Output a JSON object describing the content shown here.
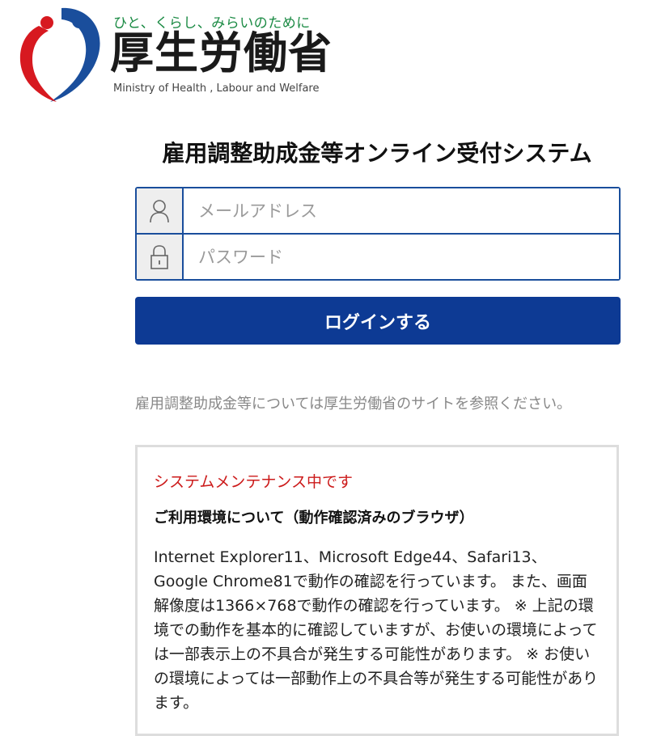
{
  "header": {
    "tagline": "ひと、くらし、みらいのために",
    "ministry_name": "厚生労働省",
    "ministry_name_en": "Ministry of Health , Labour and Welfare",
    "colors": {
      "tagline": "#1a8a43",
      "logo_blue": "#1a4e9c",
      "logo_red": "#d71920"
    }
  },
  "main": {
    "system_title": "雇用調整助成金等オンライン受付システム"
  },
  "login_form": {
    "email": {
      "placeholder": "メールアドレス",
      "value": "",
      "icon": "user-icon"
    },
    "password": {
      "placeholder": "パスワード",
      "value": "",
      "icon": "lock-icon"
    },
    "submit_label": "ログインする",
    "colors": {
      "border": "#1a4e9c",
      "button": "#0d3a94"
    }
  },
  "info": {
    "note": "雇用調整助成金等については厚生労働省のサイトを参照ください。"
  },
  "notice": {
    "alert": "システムメンテナンス中です",
    "heading": "ご利用環境について（動作確認済みのブラウザ）",
    "body": "Internet Explorer11、Microsoft Edge44、Safari13、Google Chrome81で動作の確認を行っています。 また、画面解像度は1366×768で動作の確認を行っています。 ※ 上記の環境での動作を基本的に確認していますが、お使いの環境によっては一部表示上の不具合が発生する可能性があります。 ※ お使いの環境によっては一部動作上の不具合等が発生する可能性があります。",
    "colors": {
      "alert": "#cc1a1a"
    }
  }
}
